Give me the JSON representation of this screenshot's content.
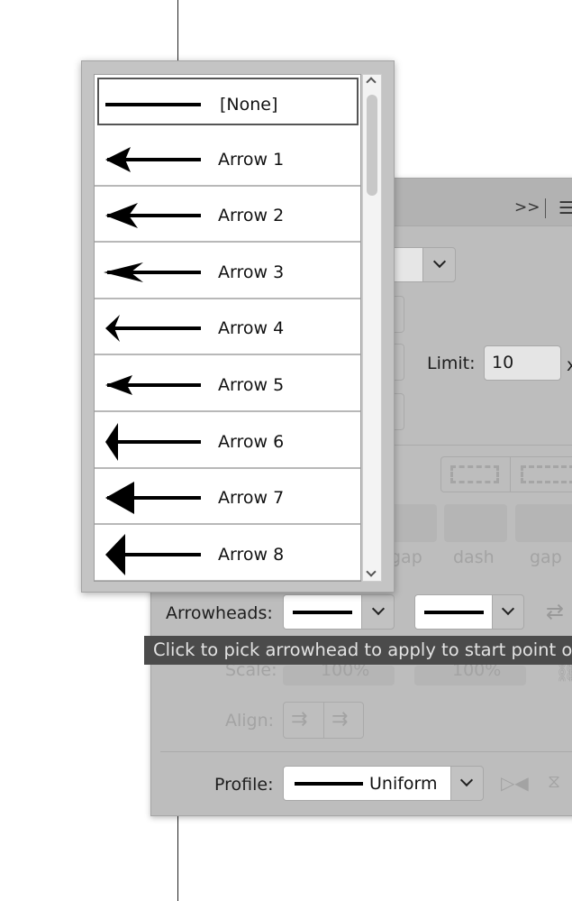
{
  "panel": {
    "header_icons": [
      "double-chevron-right-icon",
      "menu-icon"
    ],
    "limit": {
      "label": "Limit:",
      "value": "10",
      "suffix": "x"
    },
    "dash_labels": [
      "gap",
      "dash",
      "gap"
    ],
    "arrowheads": {
      "label": "Arrowheads:",
      "start": "[None]",
      "end": "[None]"
    },
    "scale": {
      "label": "Scale:",
      "start": "100%",
      "end": "100%"
    },
    "align": {
      "label": "Align:"
    },
    "profile": {
      "label": "Profile:",
      "value": "Uniform"
    }
  },
  "tooltip": "Click to pick arrowhead to apply to start point of line",
  "arrowhead_menu": {
    "selected": "[None]",
    "items": [
      {
        "label": "[None]"
      },
      {
        "label": "Arrow 1"
      },
      {
        "label": "Arrow 2"
      },
      {
        "label": "Arrow 3"
      },
      {
        "label": "Arrow 4"
      },
      {
        "label": "Arrow 5"
      },
      {
        "label": "Arrow 6"
      },
      {
        "label": "Arrow 7"
      },
      {
        "label": "Arrow 8"
      }
    ]
  }
}
